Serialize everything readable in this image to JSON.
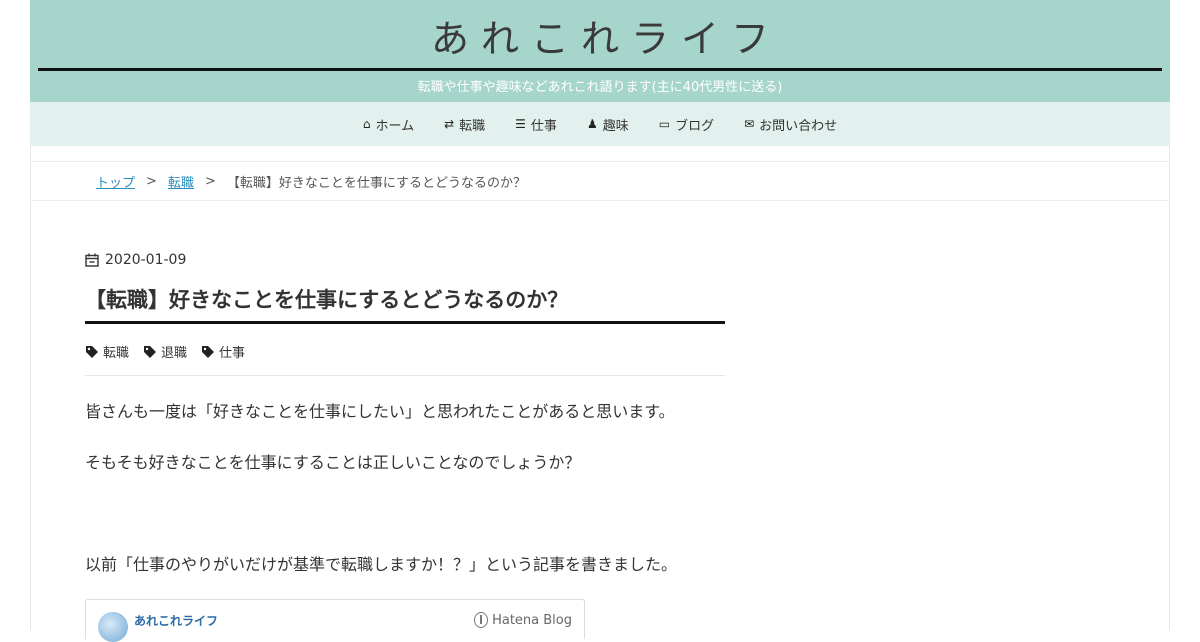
{
  "header": {
    "site_title": "あれこれライフ",
    "site_description": "転職や仕事や趣味などあれこれ語ります(主に40代男性に送る)",
    "bg_color": "#a6d5cb"
  },
  "nav": {
    "items": [
      {
        "label": "ホーム",
        "icon": "home-icon",
        "glyph": "⌂"
      },
      {
        "label": "転職",
        "icon": "exchange-icon",
        "glyph": "⇄"
      },
      {
        "label": "仕事",
        "icon": "list-icon",
        "glyph": "☰"
      },
      {
        "label": "趣味",
        "icon": "person-icon",
        "glyph": "♟"
      },
      {
        "label": "ブログ",
        "icon": "desktop-icon",
        "glyph": "▭"
      },
      {
        "label": "お問い合わせ",
        "icon": "envelope-icon",
        "glyph": "✉"
      }
    ],
    "bg_color": "#e2f1ee"
  },
  "breadcrumb": {
    "items": [
      {
        "label": "トップ",
        "link": true
      },
      {
        "label": "転職",
        "link": true
      },
      {
        "label": "【転職】好きなことを仕事にするとどうなるのか？",
        "link": false
      }
    ],
    "separator": ">"
  },
  "article": {
    "date": "2020-01-09",
    "title": "【転職】好きなことを仕事にするとどうなるのか？",
    "tags": [
      "転職",
      "退職",
      "仕事"
    ],
    "paragraphs": [
      "皆さんも一度は「好きなことを仕事にしたい」と思われたことがあると思います。",
      "そもそも好きなことを仕事にすることは正しいことなのでしょうか？",
      "以前「仕事のやりがいだけが基準で転職しますか！？」という記事を書きました。"
    ],
    "embed": {
      "site_name": "あれこれライフ",
      "brand": "Hatena Blog"
    }
  }
}
